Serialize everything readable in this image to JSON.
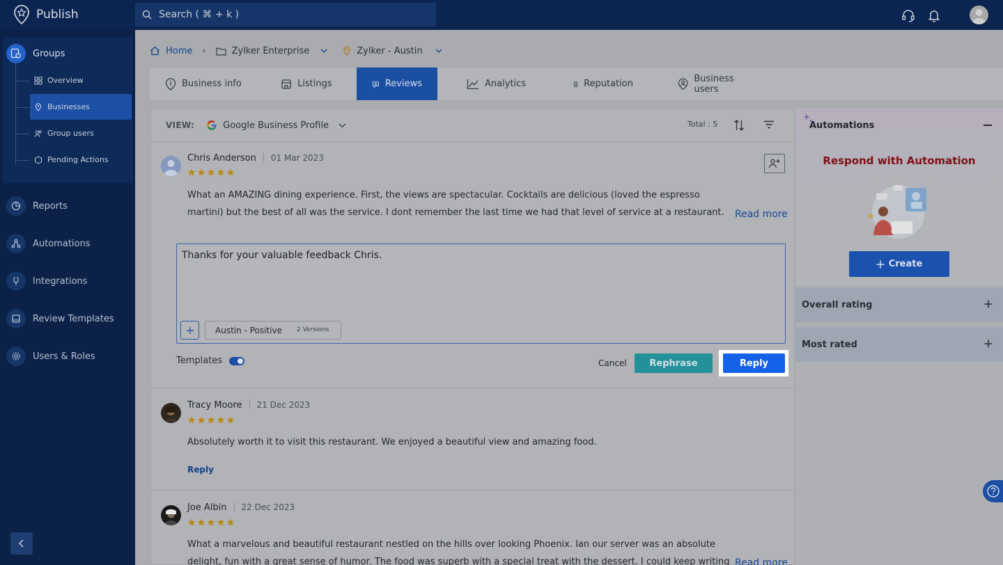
{
  "app": {
    "name": "Publish"
  },
  "search": {
    "placeholder": "Search ( ⌘ + k )"
  },
  "sidebar": {
    "group_label": "Groups",
    "sub_items": [
      {
        "label": "Overview",
        "icon": "overview-grid-icon"
      },
      {
        "label": "Businesses",
        "icon": "location-pin-icon",
        "active": true
      },
      {
        "label": "Group users",
        "icon": "users-icon"
      },
      {
        "label": "Pending Actions",
        "icon": "hexagon-icon"
      }
    ],
    "items": [
      {
        "label": "Reports",
        "icon": "pie-chart-icon"
      },
      {
        "label": "Automations",
        "icon": "automation-icon"
      },
      {
        "label": "Integrations",
        "icon": "plug-icon"
      },
      {
        "label": "Review Templates",
        "icon": "template-icon"
      },
      {
        "label": "Users & Roles",
        "icon": "gear-icon"
      }
    ]
  },
  "breadcrumb": {
    "home": "Home",
    "org": "Zylker Enterprise",
    "location": "Zylker - Austin"
  },
  "tabs": [
    {
      "label": "Business info",
      "icon": "info-icon"
    },
    {
      "label": "Listings",
      "icon": "store-icon"
    },
    {
      "label": "Reviews",
      "icon": "review-icon",
      "active": true
    },
    {
      "label": "Analytics",
      "icon": "analytics-icon"
    },
    {
      "label": "Reputation",
      "icon": "badge-icon"
    },
    {
      "label": "Business users",
      "icon": "user-icon"
    }
  ],
  "view": {
    "label": "VIEW:",
    "value": "Google Business Profile",
    "total": "Total : 5"
  },
  "reviews": [
    {
      "name": "Chris Anderson",
      "date": "01 Mar 2023",
      "rating": 5,
      "text": "What an AMAZING dining experience. First, the views are spectacular. Cocktails are delicious (loved the espresso martini) but the best of all was the service. I dont remember the last time we had that level of service at a restaurant. From the hostess to...",
      "read_more": "Read more"
    },
    {
      "name": "Tracy Moore",
      "date": "21 Dec 2023",
      "rating": 5,
      "text": "Absolutely worth it to visit this restaurant. We enjoyed a beautiful view and amazing food.",
      "reply_link": "Reply"
    },
    {
      "name": "Joe Albin",
      "date": "22 Dec 2023",
      "rating": 5,
      "text": "What a marvelous and beautiful restaurant nestled on the hills over looking Phoenix. Ian our server was an absolute delight, fun with a great sense of humor. The food was superb with a special treat with the dessert. I could keep writing forever regarding...",
      "read_more": "Read more"
    }
  ],
  "reply_editor": {
    "value": "Thanks for your valuable feedback Chris.",
    "template_name": "Austin - Positive",
    "template_versions": "2 Versions",
    "templates_label": "Templates",
    "templates_enabled": true,
    "cancel": "Cancel",
    "rephrase": "Rephrase",
    "reply": "Reply"
  },
  "right_panel": {
    "automations_title": "Automations",
    "headline": "Respond with Automation",
    "create": "Create",
    "overall_rating": "Overall rating",
    "most_rated": "Most rated"
  },
  "colors": {
    "accent": "#1462e8",
    "headline": "#7d1116",
    "star": "#b98a1c"
  }
}
